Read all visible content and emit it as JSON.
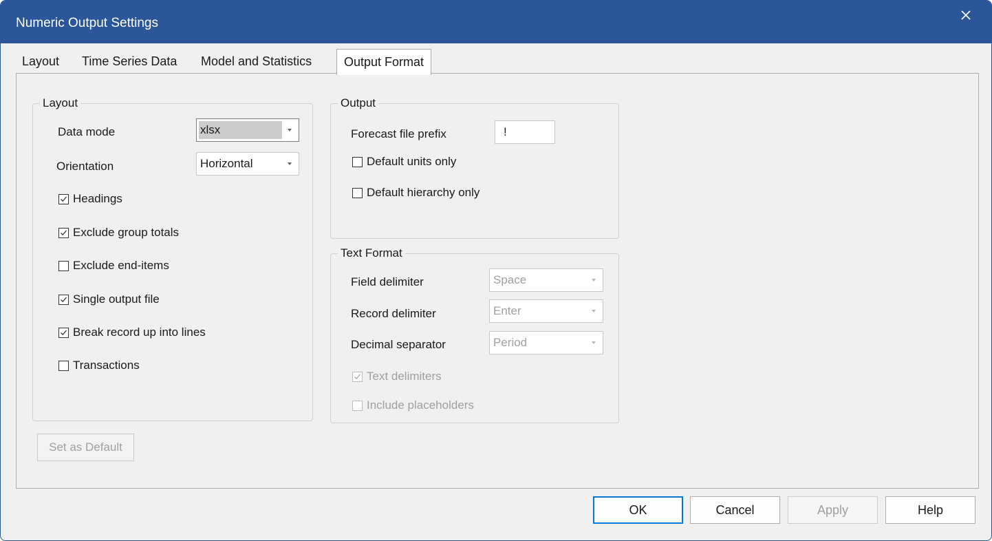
{
  "window": {
    "title": "Numeric Output Settings",
    "accent_color": "#2b579a",
    "close_icon": "close-icon"
  },
  "tabs": [
    {
      "label": "Layout"
    },
    {
      "label": "Time Series Data"
    },
    {
      "label": "Model and Statistics"
    },
    {
      "label": "Output Format",
      "active": true
    }
  ],
  "layout_group": {
    "title": "Layout",
    "data_mode": {
      "label": "Data mode",
      "value": "xlsx"
    },
    "orientation": {
      "label": "Orientation",
      "value": "Horizontal"
    },
    "checkboxes": [
      {
        "label": "Headings",
        "checked": true
      },
      {
        "label": "Exclude group totals",
        "checked": true
      },
      {
        "label": "Exclude end-items",
        "checked": false
      },
      {
        "label": "Single output file",
        "checked": true
      },
      {
        "label": "Break record up into lines",
        "checked": true
      },
      {
        "label": "Transactions",
        "checked": false
      }
    ]
  },
  "output_group": {
    "title": "Output",
    "forecast_file_prefix": {
      "label": "Forecast file prefix",
      "value": "!"
    },
    "default_units_only": {
      "label": "Default units only",
      "checked": false
    },
    "default_hierarchy_only": {
      "label": "Default hierarchy only",
      "checked": false
    }
  },
  "text_format_group": {
    "title": "Text Format",
    "field_delimiter": {
      "label": "Field delimiter",
      "value": "Space"
    },
    "record_delimiter": {
      "label": "Record delimiter",
      "value": "Enter"
    },
    "decimal_separator": {
      "label": "Decimal separator",
      "value": "Period"
    },
    "text_delimiters": {
      "label": "Text delimiters",
      "checked": true
    },
    "include_placeholders": {
      "label": "Include placeholders",
      "checked": false
    }
  },
  "set_default_label": "Set as Default",
  "buttons": {
    "ok": "OK",
    "cancel": "Cancel",
    "apply": "Apply",
    "help": "Help"
  }
}
